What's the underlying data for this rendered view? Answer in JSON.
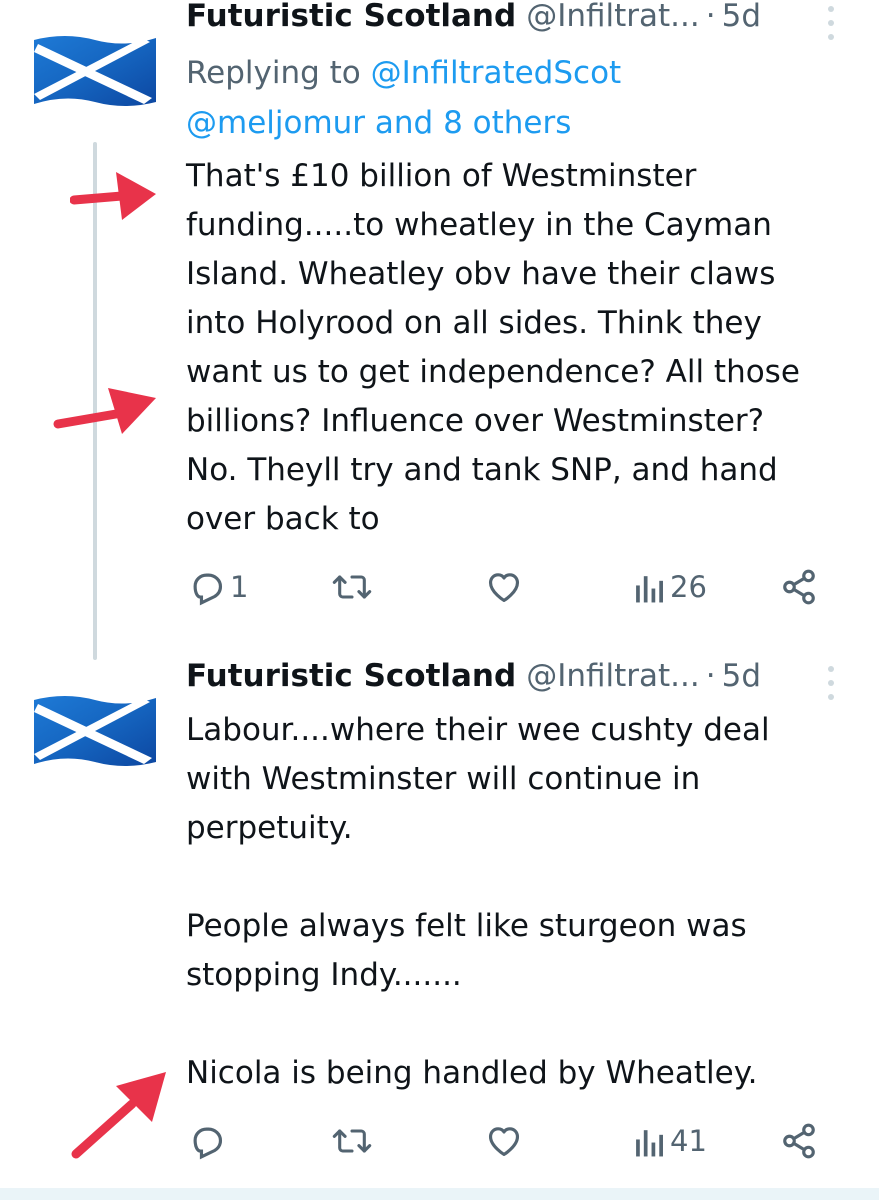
{
  "tweets": [
    {
      "display_name": "Futuristic Scotland",
      "handle": "@Infiltrat...",
      "separator": "·",
      "time": "5d",
      "reply_prefix": "Replying to ",
      "reply_to": "@InfiltratedScot",
      "reply_others": "@meljomur and 8 others",
      "text": "That's £10 billion of Westminster\nfunding.....to wheatley in the Cayman\nIsland. Wheatley obv have their claws\ninto Holyrood on all sides. Think they\nwant us to get independence? All those\nbillions? Influence over Westminster?\nNo. Theyll try and tank SNP, and hand\nover back to",
      "reply_count": "1",
      "view_count": "26"
    },
    {
      "display_name": "Futuristic Scotland",
      "handle": "@Infiltrat...",
      "separator": "·",
      "time": "5d",
      "text": "Labour....where their wee cushty deal\nwith Westminster will continue in\nperpetuity.\n\nPeople always felt like sturgeon was\nstopping Indy.......\n\nNicola is being handled by Wheatley.",
      "view_count": "41"
    }
  ],
  "icons": {
    "reply": "reply-icon",
    "retweet": "retweet-icon",
    "like": "heart-icon",
    "views": "views-icon",
    "share": "share-icon",
    "more": "more-vertical-icon",
    "avatar": "scotland-flag-avatar",
    "annotation": "red-arrow-icon"
  },
  "colors": {
    "text": "#0f1419",
    "secondary": "#536471",
    "link": "#1d9bf0",
    "thread_line": "#cfd9de",
    "flag_blue": "#1565c0",
    "arrow_red": "#e8334a"
  }
}
